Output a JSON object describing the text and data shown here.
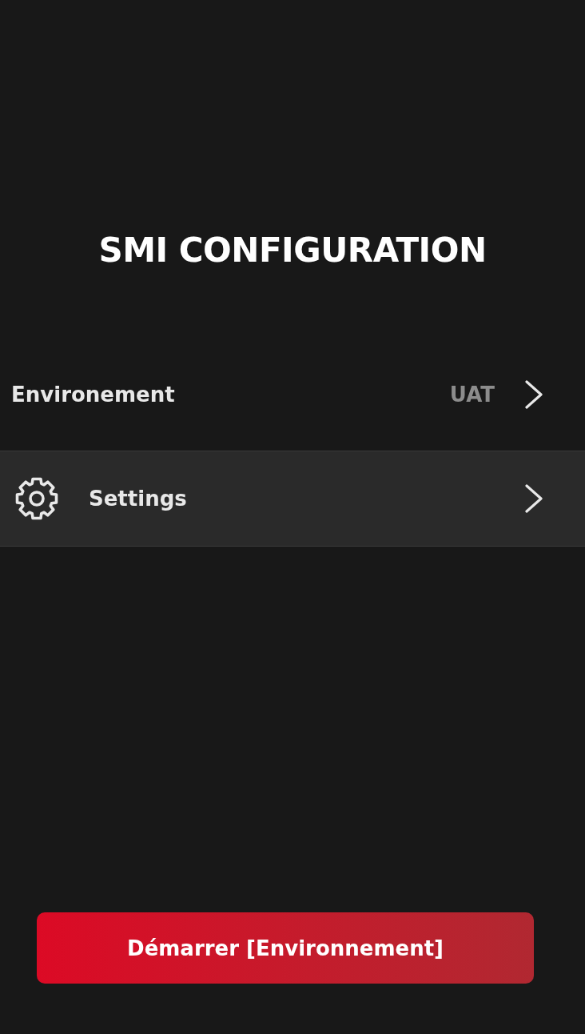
{
  "title": "SMI CONFIGURATION",
  "menu": [
    {
      "kind": "value",
      "label": "Environement",
      "value": "UAT"
    },
    {
      "kind": "icon",
      "label": "Settings"
    }
  ],
  "start_button": {
    "label": "Démarrer [Environnement]"
  }
}
